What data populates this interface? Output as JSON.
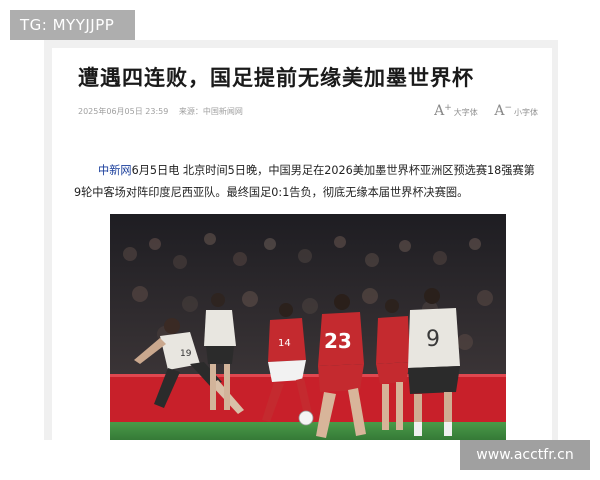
{
  "watermark_top": "TG: MYYJJPP",
  "watermark_bottom": "www.acctfr.cn",
  "article": {
    "title": "遭遇四连败，国足提前无缘美加墨世界杯",
    "date": "2025年06月05日 23:59",
    "source": "来源：中国新闻网",
    "font_large_label": "大字体",
    "font_small_label": "小字体",
    "lead_source": "中新网",
    "lead_text": "6月5日电 北京时间5日晚，中国男足在2026美加墨世界杯亚洲区预选赛18强赛第9轮中客场对阵印度尼西亚队。最终国足0:1告负，彻底无缘本届世界杯决赛圈。"
  },
  "photo": {
    "jersey_numbers": [
      "19",
      "14",
      "23",
      "9"
    ],
    "colors": {
      "pitch": "#3d8a3f",
      "ad_board": "#c8202a",
      "red_kit": "#c42a2f",
      "white_kit": "#e8e6e0",
      "crowd": "#2b2a2e"
    }
  }
}
